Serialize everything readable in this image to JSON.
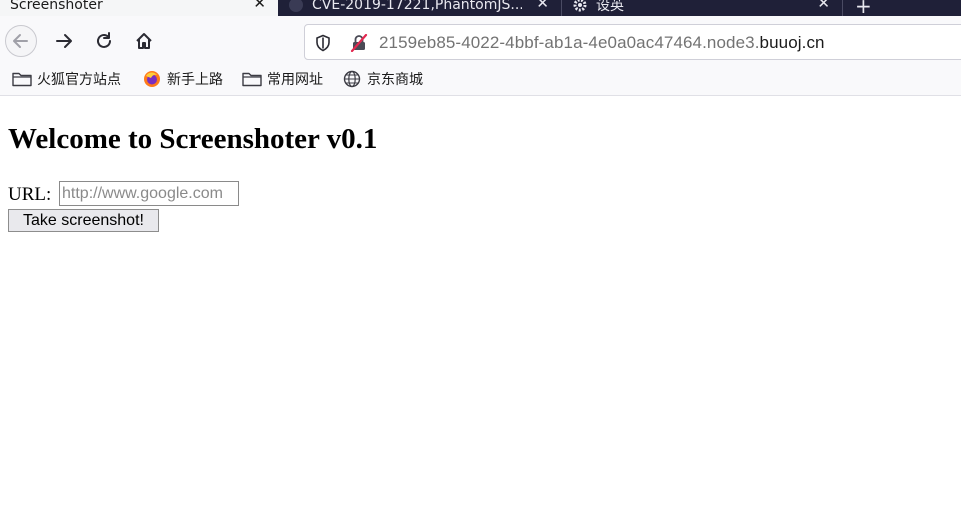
{
  "tabs": [
    {
      "title": "Screenshoter",
      "active": true,
      "close_glyph": "✕"
    },
    {
      "title": "CVE-2019-17221,PhantomJS...",
      "active": false,
      "close_glyph": "✕"
    },
    {
      "title": "设英",
      "active": false,
      "close_glyph": "✕"
    }
  ],
  "new_tab_glyph": "+",
  "toolbar": {
    "url_prefix": "2159eb85-4022-4bbf-ab1a-4e0a0ac47464.node3.",
    "url_domain": "buuoj.cn"
  },
  "bookmarks": [
    {
      "label": "火狐官方站点",
      "icon": "folder-icon"
    },
    {
      "label": "新手上路",
      "icon": "firefox-icon"
    },
    {
      "label": "常用网址",
      "icon": "folder-icon"
    },
    {
      "label": "京东商城",
      "icon": "globe-icon"
    }
  ],
  "page": {
    "title": "Welcome to Screenshoter v0.1",
    "url_label": "URL:",
    "url_placeholder": "http://www.google.com",
    "url_value": "",
    "submit_label": "Take screenshot!"
  },
  "colors": {
    "tabbar_bg": "#1f2038",
    "toolbar_bg": "#f9f9fb"
  }
}
